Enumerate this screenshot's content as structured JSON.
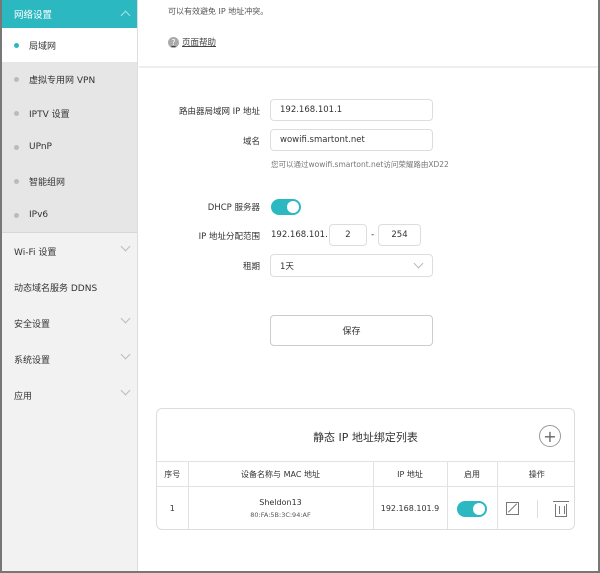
{
  "sidebar": {
    "header": "网络设置",
    "sub_items": [
      {
        "label": "局域网",
        "active": true
      },
      {
        "label": "虚拟专用网 VPN"
      },
      {
        "label": "IPTV 设置"
      },
      {
        "label": "UPnP"
      },
      {
        "label": "智能组网"
      },
      {
        "label": "IPv6"
      }
    ],
    "items": [
      {
        "label": "Wi-Fi 设置"
      },
      {
        "label": "动态域名服务 DDNS"
      },
      {
        "label": "安全设置"
      },
      {
        "label": "系统设置"
      },
      {
        "label": "应用"
      }
    ]
  },
  "main": {
    "top_note": "可以有效避免 IP 地址冲突。",
    "help": "页面帮助",
    "router_ip_label": "路由器局域网 IP 地址",
    "router_ip": "192.168.101.1",
    "domain_label": "域名",
    "domain": "wowifi.smartont.net",
    "domain_hint": "您可以通过wowifi.smartont.net访问荣耀路由XD22",
    "dhcp_label": "DHCP 服务器",
    "dhcp_enabled": true,
    "range_label": "IP 地址分配范围",
    "range_prefix": "192.168.101.",
    "range_start": "2",
    "range_dash": "-",
    "range_end": "254",
    "lease_label": "租期",
    "lease": "1天",
    "save": "保存"
  },
  "static_table": {
    "title": "静态 IP 地址绑定列表",
    "add": "+",
    "columns": [
      "序号",
      "设备名称与 MAC 地址",
      "IP 地址",
      "启用",
      "操作"
    ],
    "rows": [
      {
        "index": "1",
        "name": "Sheldon13",
        "mac": "80:FA:5B:3C:94:AF",
        "ip": "192.168.101.9",
        "enabled": true
      }
    ]
  },
  "colors": {
    "accent": "#2bb8c1"
  }
}
